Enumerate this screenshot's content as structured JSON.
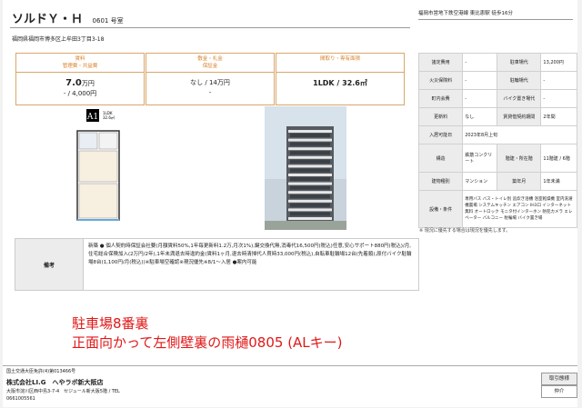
{
  "header": {
    "property_name": "ソルドＹ・Ｈ",
    "room": "0601 号室",
    "address": "福岡県福岡市博多区上牟田3丁目3-18",
    "access": "福岡市営地下鉄空港線 東比恵駅 徒歩16分"
  },
  "summary": [
    {
      "head1": "賃料",
      "head2": "管理費・共益費",
      "value1": "7.0",
      "value1_unit": "万円",
      "value2": "- / 4,000円"
    },
    {
      "head1": "敷金・礼金",
      "head2": "保証金",
      "value1": "なし / 14万円",
      "value1_unit": "",
      "value2": "-"
    },
    {
      "head1": "間取り・専有面積",
      "head2": "",
      "value1": "1LDK / 32.6㎡",
      "value1_unit": "",
      "value2": ""
    }
  ],
  "spec": [
    [
      "諸定費用",
      "-",
      "駐車場代",
      "13,200円"
    ],
    [
      "火災保険料",
      "-",
      "駐輪場代",
      "-"
    ],
    [
      "町内会費",
      "-",
      "バイク置き場代",
      "-"
    ],
    [
      "更新料",
      "なし",
      "賃貸借契約期間",
      "2年間"
    ],
    [
      "入居可能日",
      "2023年8月上旬",
      "",
      ""
    ],
    [
      "構造",
      "鉄筋コンクリート",
      "階建・所在階",
      "11階建 / 6階"
    ],
    [
      "建物種別",
      "マンション",
      "築年月",
      "1年未満"
    ],
    [
      "設備・条件",
      "専用バス バス・トイレ別 追炊き浴槽 浴室乾燥機 室内洗濯機置場 システムキッチン エアコン IH3口 インターネット無料 オートロック モニタ付インターホン 防犯カメラ エレベーター バルコニー 駐輪場 バイク置き場",
      "",
      ""
    ]
  ],
  "note_small": "※ 現況に優先する場合は現況を優先します。",
  "floorplan": {
    "badge": "A1",
    "type": "1LDK",
    "area": "32.6㎡"
  },
  "biko": {
    "label": "備考",
    "text": "新築 ● 個人契約時保証会社要(月額賃料50%,1年毎更新料1.2万,月次1%),鍵交換代無,消毒代16,500円(税込)任意,安心サポート880円(税込)/月,住宅総合保険加入(2万円/2年),1年未満退去時違約金(賃料1ヶ月,退去時清掃代人買時33,000円(税込),自転車駐輪場12台(先着順),原付バイク駐輪場8台(1,100円/月(税込))※駐車場空確認※現況優先※8/1～入居 ●案内可能"
  },
  "memo": {
    "line1": "駐車場8番裏",
    "line2": "正面向かって左側壁裏の雨樋0805 (ALキー)"
  },
  "footer": {
    "license": "国土交通大臣免許(4)第013466号",
    "agency": "株式会社LI.G　へやラボ新大阪店",
    "address": "大阪市淀川区西中島3-7-4　セジュール新大阪5階 / TEL",
    "tel": "0661005561",
    "box1": "取引態様",
    "box2": "仲介"
  },
  "colors": {
    "accent": "#d9822b",
    "memo_red": "#e01818"
  }
}
